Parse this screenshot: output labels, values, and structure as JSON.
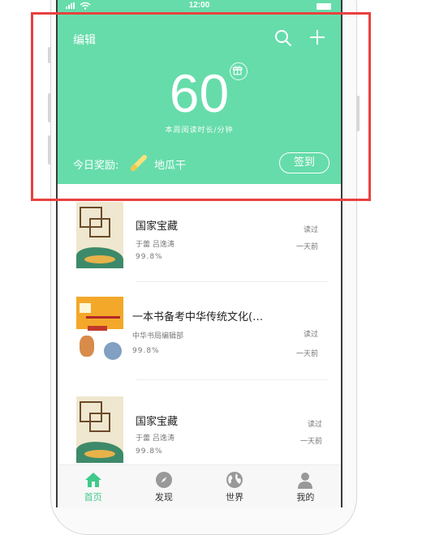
{
  "status_bar": {
    "time": "12:00"
  },
  "header": {
    "edit_label": "编辑",
    "weekly_minutes": "60",
    "caption": "本周阅读时长/分钟",
    "reward_label": "今日奖励:",
    "reward_value": "地瓜干",
    "checkin_label": "签到"
  },
  "books": [
    {
      "title": "国家宝藏",
      "author": "于蕾 吕逸涛",
      "progress": "99.8%",
      "status": "读过",
      "time": "一天前"
    },
    {
      "title": "一本书备考中华传统文化(…",
      "author": "中华书局编辑部",
      "progress": "99.8%",
      "status": "读过",
      "time": "一天前"
    },
    {
      "title": "国家宝藏",
      "author": "于蕾 吕逸涛",
      "progress": "99.8%",
      "status": "读过",
      "time": "一天前"
    }
  ],
  "tabs": [
    {
      "label": "首页",
      "icon": "home-icon",
      "active": true
    },
    {
      "label": "发现",
      "icon": "compass-icon",
      "active": false
    },
    {
      "label": "世界",
      "icon": "globe-icon",
      "active": false
    },
    {
      "label": "我的",
      "icon": "user-icon",
      "active": false
    }
  ],
  "colors": {
    "brand": "#66dcaa",
    "highlight": "#e8413f",
    "tab_active": "#3fc98a"
  }
}
